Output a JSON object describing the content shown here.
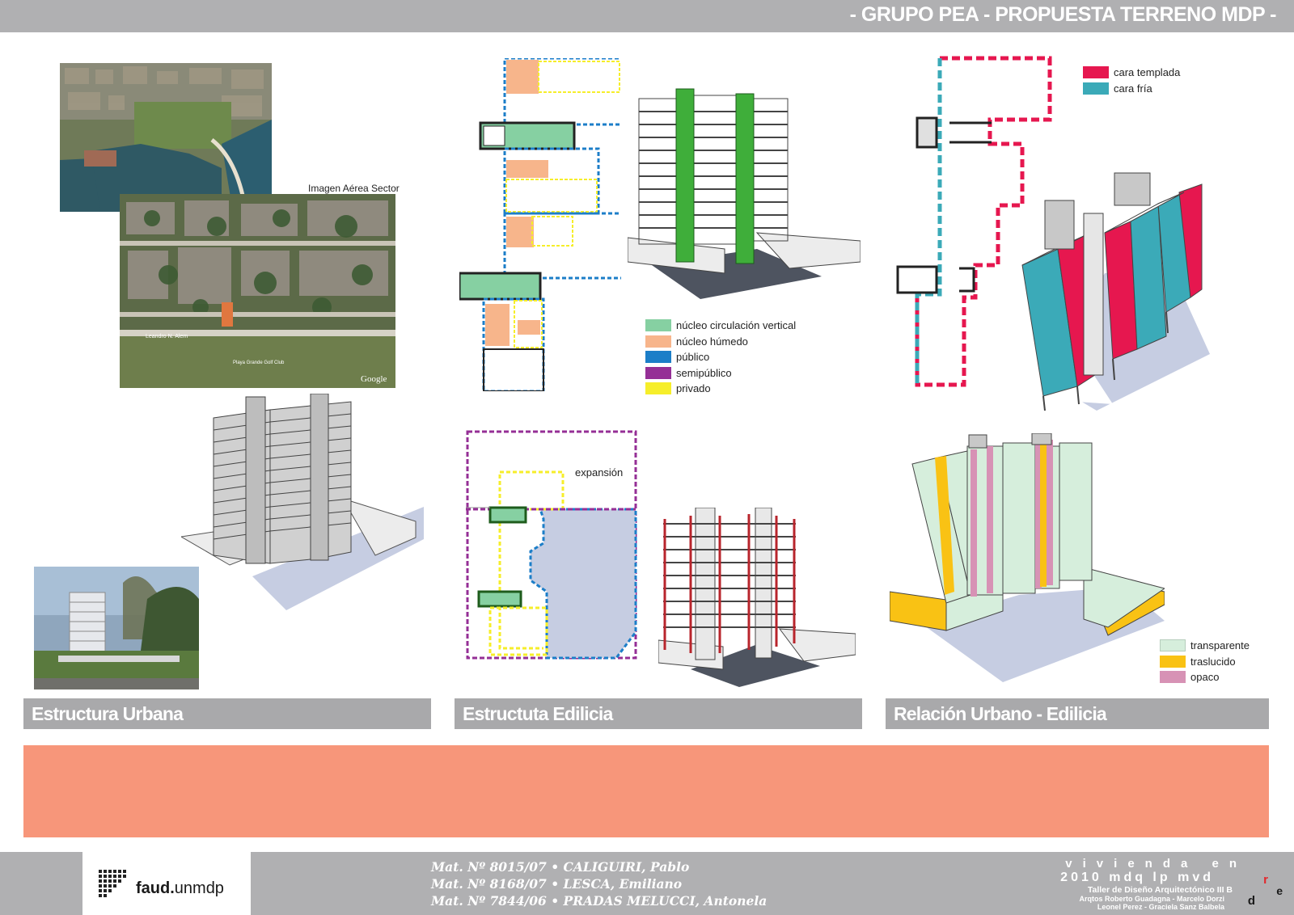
{
  "header": {
    "title": "- GRUPO PEA - PROPUESTA TERRENO MDP -"
  },
  "section1": {
    "label": "Estructura Urbana",
    "aerial_caption": "Imagen Aérea Sector",
    "map_labels": [
      "Leandro N. Alem",
      "Playa Grande Golf Club",
      "Google"
    ]
  },
  "section2": {
    "label": "Estructuta Edilicia",
    "expansion": "expansión",
    "legend": [
      {
        "label": "núcleo circulación vertical",
        "color": "#86d0a2"
      },
      {
        "label": "núcleo húmedo",
        "color": "#f7b58b"
      },
      {
        "label": "público",
        "color": "#1c7ec8"
      },
      {
        "label": "semipúblico",
        "color": "#952f96"
      },
      {
        "label": "privado",
        "color": "#f6ee2a"
      }
    ]
  },
  "section3": {
    "label": "Relación Urbano - Edilicia",
    "legend_top": [
      {
        "label": "cara templada",
        "color": "#e6174f"
      },
      {
        "label": "cara fría",
        "color": "#3baab8"
      }
    ],
    "legend_bottom": [
      {
        "label": "transparente",
        "color": "#d6eedc"
      },
      {
        "label": "traslucido",
        "color": "#f9c214"
      },
      {
        "label": "opaco",
        "color": "#d792b5"
      }
    ]
  },
  "footer": {
    "logo_bold": "faud.",
    "logo_rest": "unmdp",
    "authors": [
      "Mat. Nº 8015/07 • CALIGUIRI, Pablo",
      "Mat. Nº 8168/07  • LESCA, Emiliano",
      "Mat. Nº 7844/06 • PRADAS MELUCCI, Antonela"
    ],
    "project": {
      "title": "vivienda en",
      "subtitle": "2010 mdq lp mvd",
      "workshop": "Taller de Diseño Arquitectónico III B",
      "teachers1": "Arqtos Roberto Guadagna - Marcelo Dorzi",
      "teachers2": "Leonel Perez - Graciela Sanz Balbela",
      "mark_r": "r",
      "mark_d": "d",
      "mark_e": "e"
    }
  },
  "colors": {
    "accent_band": "#f7967a",
    "bar_gray": "#b0b0b2"
  }
}
